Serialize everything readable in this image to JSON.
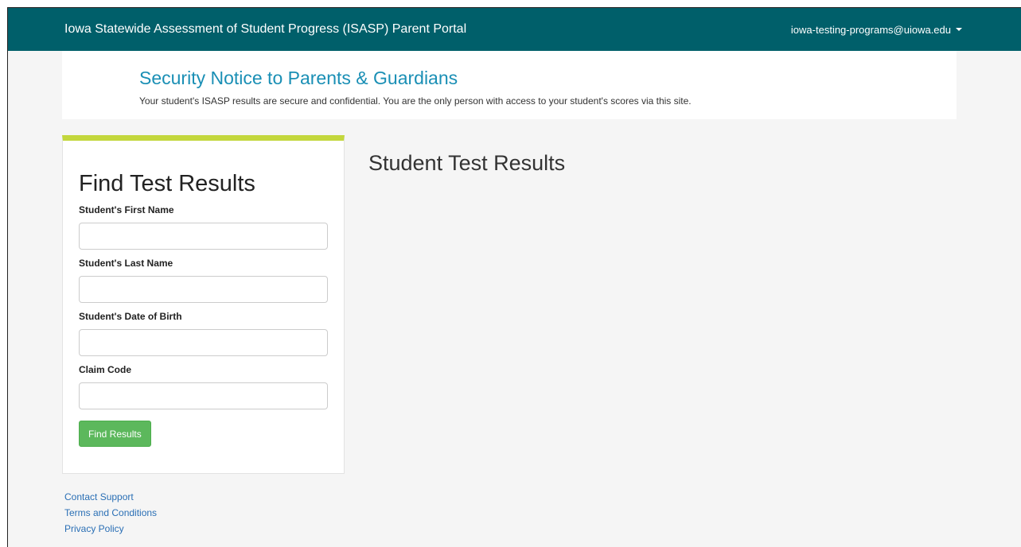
{
  "header": {
    "title": "Iowa Statewide Assessment of Student Progress (ISASP) Parent Portal",
    "user_email": "iowa-testing-programs@uiowa.edu"
  },
  "notice": {
    "title": "Security Notice to Parents & Guardians",
    "text": "Your student's ISASP results are secure and confidential. You are the only person with access to your student's scores via this site."
  },
  "search_panel": {
    "title": "Find Test Results",
    "fields": [
      {
        "label": "Student's First Name",
        "value": ""
      },
      {
        "label": "Student's Last Name",
        "value": ""
      },
      {
        "label": "Student's Date of Birth",
        "value": ""
      },
      {
        "label": "Claim Code",
        "value": ""
      }
    ],
    "submit_label": "Find Results"
  },
  "results": {
    "title": "Student Test Results"
  },
  "footer": {
    "links": [
      "Contact Support",
      "Terms and Conditions",
      "Privacy Policy"
    ]
  },
  "colors": {
    "navbar": "#005f6a",
    "notice_title": "#1a8fb5",
    "panel_accent": "#c3d73c",
    "button": "#5cb85c",
    "link": "#2a6fb5"
  },
  "icons": {
    "user_menu": "caret-down-icon"
  }
}
